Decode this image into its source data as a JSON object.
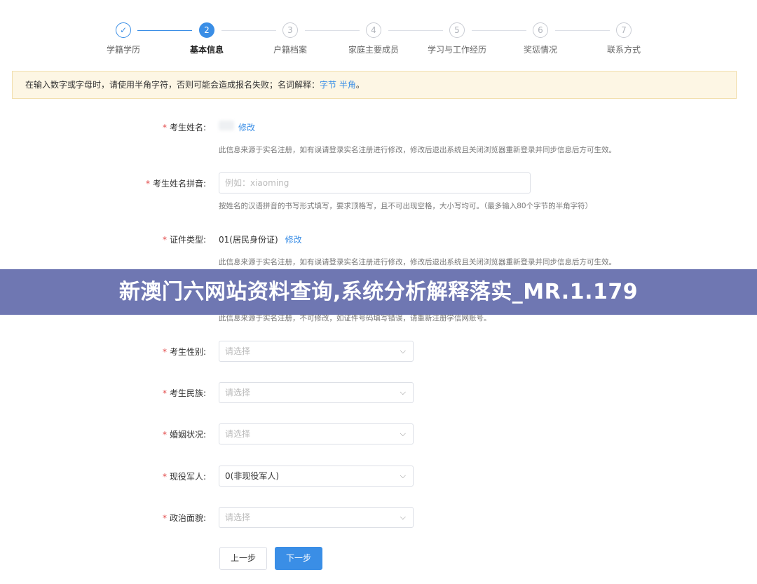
{
  "steps": [
    {
      "num": "✓",
      "label": "学籍学历"
    },
    {
      "num": "2",
      "label": "基本信息"
    },
    {
      "num": "3",
      "label": "户籍档案"
    },
    {
      "num": "4",
      "label": "家庭主要成员"
    },
    {
      "num": "5",
      "label": "学习与工作经历"
    },
    {
      "num": "6",
      "label": "奖惩情况"
    },
    {
      "num": "7",
      "label": "联系方式"
    }
  ],
  "notice": {
    "text": "在输入数字或字母时，请使用半角字符，否则可能会造成报名失败；名词解释：",
    "link": "字节 半角",
    "end": "。"
  },
  "form": {
    "name": {
      "label": "考生姓名:",
      "edit": "修改",
      "hint": "此信息来源于实名注册，如有误请登录实名注册进行修改，修改后退出系统且关闭浏览器重新登录并同步信息后方可生效。"
    },
    "pinyin": {
      "label": "考生姓名拼音:",
      "placeholder": "例如：xiaoming",
      "hint": "按姓名的汉语拼音的书写形式填写，要求顶格写，且不可出现空格，大小写均可。（最多输入80个字节的半角字符）"
    },
    "idtype": {
      "label": "证件类型:",
      "value": "01(居民身份证)",
      "edit": "修改",
      "hint": "此信息来源于实名注册，如有误请登录实名注册进行修改，修改后退出系统且关闭浏览器重新登录并同步信息后方可生效。"
    },
    "idnum": {
      "hint": "此信息来源于实名注册，不可修改，如证件号码填写错误，请重新注册学信网账号。"
    },
    "gender": {
      "label": "考生性别:",
      "placeholder": "请选择"
    },
    "ethnic": {
      "label": "考生民族:",
      "placeholder": "请选择"
    },
    "marital": {
      "label": "婚姻状况:",
      "placeholder": "请选择"
    },
    "military": {
      "label": "现役军人:",
      "value": "0(非现役军人)"
    },
    "political": {
      "label": "政治面貌:",
      "placeholder": "请选择"
    }
  },
  "buttons": {
    "prev": "上一步",
    "next": "下一步"
  },
  "banner": "新澳门六网站资料查询,系统分析解释落实_MR.1.179",
  "colors": {
    "accent": "#3a8ee6",
    "required": "#e24a4a",
    "notice_bg": "#fdf6e4",
    "banner_bg": "#5f68aa"
  }
}
